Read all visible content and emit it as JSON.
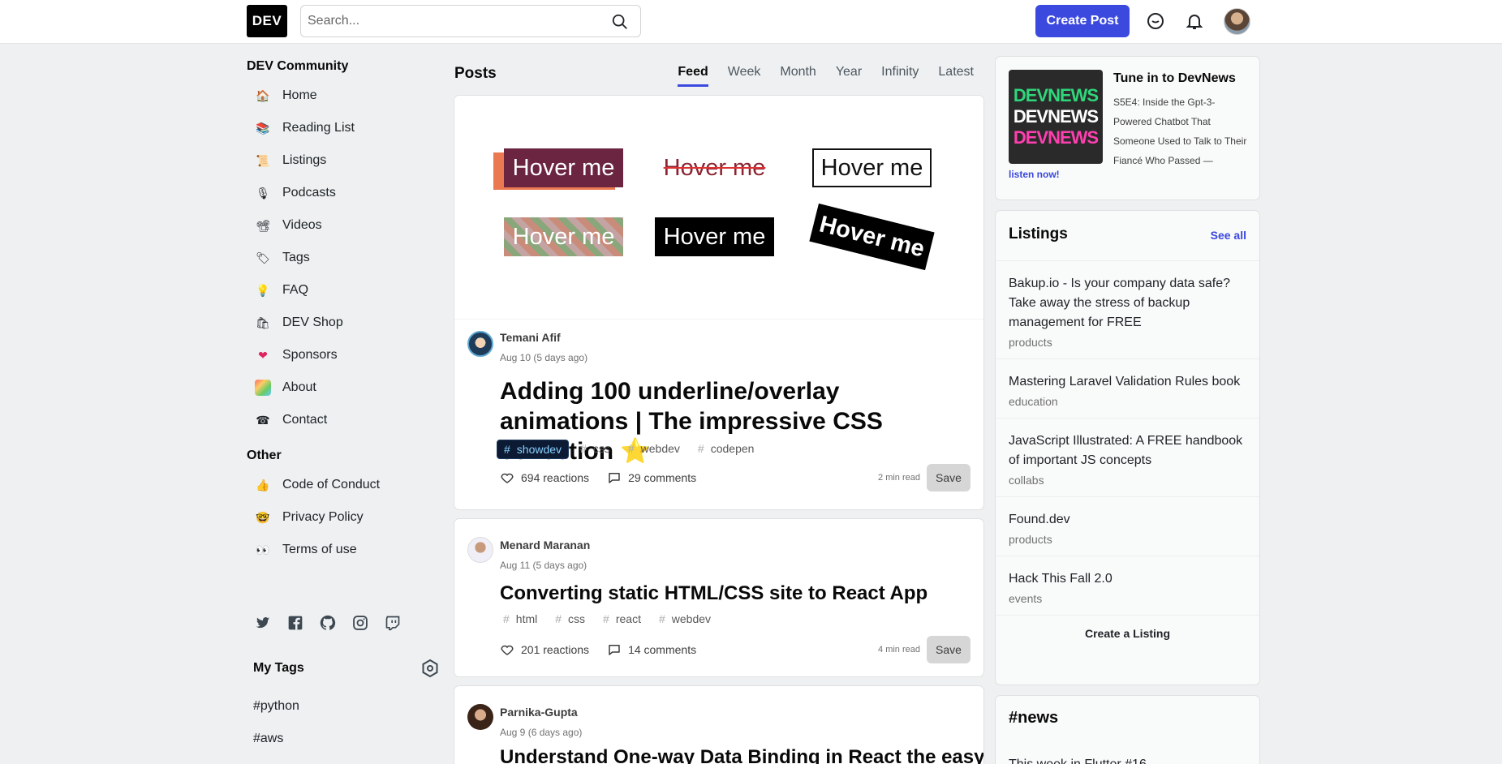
{
  "header": {
    "logo": "DEV",
    "search_placeholder": "Search...",
    "create_post": "Create Post"
  },
  "left": {
    "community_title": "DEV Community",
    "nav": [
      {
        "label": "Home",
        "icon": "house-icon"
      },
      {
        "label": "Reading List",
        "icon": "reading-list-icon"
      },
      {
        "label": "Listings",
        "icon": "listings-icon"
      },
      {
        "label": "Podcasts",
        "icon": "microphone-icon"
      },
      {
        "label": "Videos",
        "icon": "video-camera-icon"
      },
      {
        "label": "Tags",
        "icon": "tag-icon"
      },
      {
        "label": "FAQ",
        "icon": "lightbulb-icon"
      },
      {
        "label": "DEV Shop",
        "icon": "shopping-bags-icon"
      },
      {
        "label": "Sponsors",
        "icon": "heart-icon"
      },
      {
        "label": "About",
        "icon": "dev-rainbow-icon"
      },
      {
        "label": "Contact",
        "icon": "contact-icon"
      }
    ],
    "other_title": "Other",
    "other": [
      {
        "label": "Code of Conduct",
        "icon": "thumbs-up-icon"
      },
      {
        "label": "Privacy Policy",
        "icon": "nerd-face-icon"
      },
      {
        "label": "Terms of use",
        "icon": "eyes-icon"
      }
    ],
    "my_tags_title": "My Tags",
    "my_tags": [
      "#python",
      "#aws"
    ]
  },
  "feed": {
    "title": "Posts",
    "tabs": [
      "Feed",
      "Week",
      "Month",
      "Year",
      "Infinity",
      "Latest"
    ],
    "active_tab": "Feed",
    "cover_label": "Hover me",
    "posts": [
      {
        "author": "Temani Afif",
        "date": "Aug 10 (5 days ago)",
        "title": "Adding 100 underline/overlay animations | The impressive CSS collection ⭐",
        "tags": [
          "showdev",
          "css",
          "webdev",
          "codepen"
        ],
        "reactions": "694 reactions",
        "comments": "29 comments",
        "read_time": "2 min read",
        "save": "Save"
      },
      {
        "author": "Menard Maranan",
        "date": "Aug 11 (5 days ago)",
        "title": "Converting static HTML/CSS site to React App",
        "tags": [
          "html",
          "css",
          "react",
          "webdev"
        ],
        "reactions": "201 reactions",
        "comments": "14 comments",
        "read_time": "4 min read",
        "save": "Save"
      },
      {
        "author": "Parnika-Gupta",
        "date": "Aug 9 (6 days ago)",
        "title": "Understand One-way Data Binding in React the easy"
      }
    ]
  },
  "right": {
    "devnews": {
      "title": "Tune in to DevNews",
      "desc": "S5E4: Inside the Gpt-3-Powered Chatbot That Someone Used to Talk to Their Fiancé Who Passed —",
      "link": "listen now!",
      "image_words": [
        "DEVNEWS",
        "DEVNEWS",
        "DEVNEWS"
      ]
    },
    "listings": {
      "title": "Listings",
      "see_all": "See all",
      "items": [
        {
          "title": "Bakup.io - Is your company data safe? Take away the stress of backup management for FREE",
          "category": "products"
        },
        {
          "title": "Mastering Laravel Validation Rules book",
          "category": "education"
        },
        {
          "title": "JavaScript Illustrated: A FREE handbook of important JS concepts",
          "category": "collabs"
        },
        {
          "title": "Found.dev",
          "category": "products"
        },
        {
          "title": "Hack This Fall 2.0",
          "category": "events"
        }
      ],
      "create": "Create a Listing"
    },
    "news": {
      "title": "#news",
      "first_item": "This week in Flutter #16"
    }
  }
}
